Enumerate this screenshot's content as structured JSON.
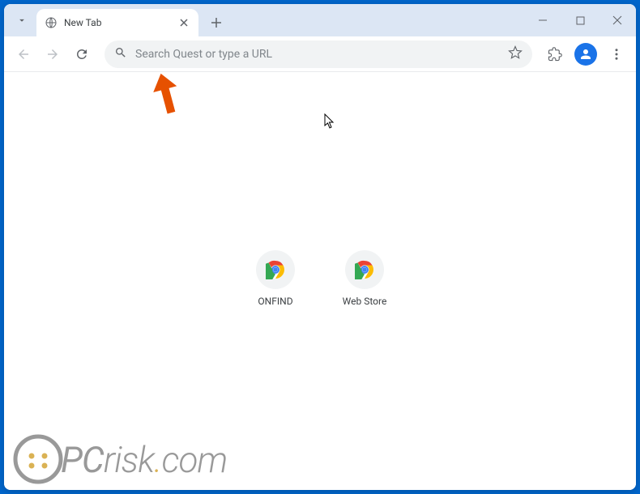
{
  "tab": {
    "title": "New Tab"
  },
  "omnibox": {
    "placeholder": "Search Quest or type a URL"
  },
  "shortcuts": [
    {
      "label": "ONFIND"
    },
    {
      "label": "Web Store"
    }
  ],
  "watermark": {
    "text_pc": "PC",
    "text_risk": "risk",
    "text_com": "com"
  }
}
